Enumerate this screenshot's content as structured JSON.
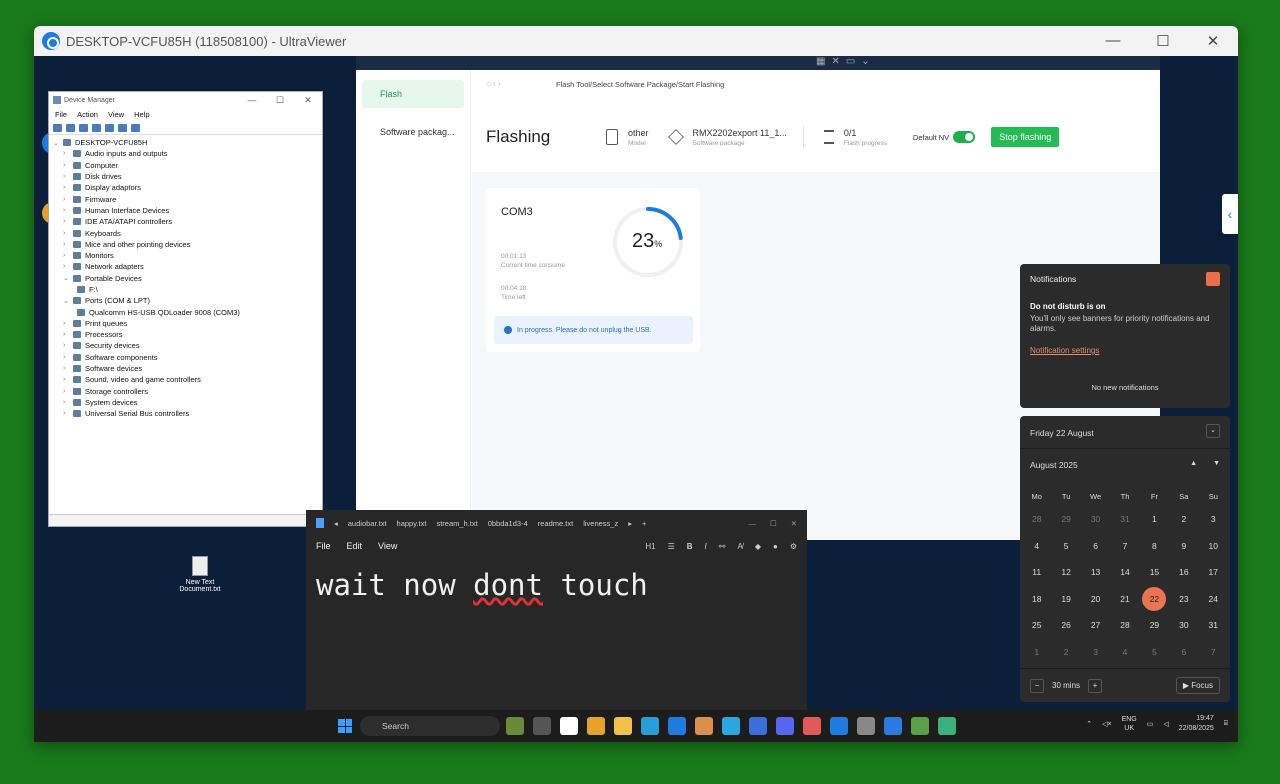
{
  "window": {
    "title": "DESKTOP-VCFU85H (118508100) - UltraViewer",
    "controls": [
      "—",
      "☐",
      "✕"
    ]
  },
  "device_manager": {
    "title": "Device Manager",
    "menu": [
      "File",
      "Action",
      "View",
      "Help"
    ],
    "root": "DESKTOP-VCFU85H",
    "items": [
      {
        "label": "Audio inputs and outputs",
        "indent": 1,
        "chev": "›"
      },
      {
        "label": "Computer",
        "indent": 1,
        "chev": "›"
      },
      {
        "label": "Disk drives",
        "indent": 1,
        "chev": "›"
      },
      {
        "label": "Display adaptors",
        "indent": 1,
        "chev": "›"
      },
      {
        "label": "Firmware",
        "indent": 1,
        "chev": "›"
      },
      {
        "label": "Human Interface Devices",
        "indent": 1,
        "chev": "›"
      },
      {
        "label": "IDE ATA/ATAPI controllers",
        "indent": 1,
        "chev": "›"
      },
      {
        "label": "Keyboards",
        "indent": 1,
        "chev": "›"
      },
      {
        "label": "Mice and other pointing devices",
        "indent": 1,
        "chev": "›"
      },
      {
        "label": "Monitors",
        "indent": 1,
        "chev": "›"
      },
      {
        "label": "Network adapters",
        "indent": 1,
        "chev": "›"
      },
      {
        "label": "Portable Devices",
        "indent": 1,
        "chev": "⌄"
      },
      {
        "label": "F:\\",
        "indent": 2,
        "chev": ""
      },
      {
        "label": "Ports (COM & LPT)",
        "indent": 1,
        "chev": "⌄"
      },
      {
        "label": "Qualcomm HS-USB QDLoader 9008 (COM3)",
        "indent": 2,
        "chev": ""
      },
      {
        "label": "Print queues",
        "indent": 1,
        "chev": "›"
      },
      {
        "label": "Processors",
        "indent": 1,
        "chev": "›"
      },
      {
        "label": "Security devices",
        "indent": 1,
        "chev": "›"
      },
      {
        "label": "Software components",
        "indent": 1,
        "chev": "›"
      },
      {
        "label": "Software devices",
        "indent": 1,
        "chev": "›"
      },
      {
        "label": "Sound, video and game controllers",
        "indent": 1,
        "chev": "›"
      },
      {
        "label": "Storage controllers",
        "indent": 1,
        "chev": "›"
      },
      {
        "label": "System devices",
        "indent": 1,
        "chev": "›"
      },
      {
        "label": "Universal Serial Bus controllers",
        "indent": 1,
        "chev": "›"
      }
    ]
  },
  "desktop": {
    "new_text": "New Text Document.txt"
  },
  "flash_tool": {
    "breadcrumb": "Flash Tool/Select Software Package/Start Flashing",
    "sidebar": [
      "Flash",
      "Software packag..."
    ],
    "heading": "Flashing",
    "model_value": "other",
    "model_label": "Model",
    "package_value": "RMX2202export 11_1...",
    "package_label": "Software package",
    "progress_value": "0/1",
    "progress_label": "Flash progress",
    "default_nv": "Default NV",
    "stop_button": "Stop flashing",
    "card": {
      "port": "COM3",
      "elapsed": "00:01:13",
      "elapsed_label": "Current time consume",
      "remaining": "00:04:18",
      "remaining_label": "Time left",
      "percent": "23",
      "percent_unit": "%",
      "progress_fraction": 0.23,
      "info": "In progress. Please do not unplug the USB."
    }
  },
  "notepad": {
    "tabs": [
      "audiobar.txt",
      "happy.txt",
      "stream_h.txt",
      "0bbda1d3-4",
      "readme.txt",
      "liveness_z"
    ],
    "menu": [
      "File",
      "Edit",
      "View"
    ],
    "heading_select": "H1",
    "text_before": "wait now ",
    "text_misspelled": "dont",
    "text_after": " touch"
  },
  "notifications": {
    "title": "Notifications",
    "dnd_title": "Do not disturb is on",
    "dnd_desc": "You'll only see banners for priority notifications and alarms.",
    "settings_link": "Notification settings",
    "empty": "No new notifications"
  },
  "calendar": {
    "date_header": "Friday 22 August",
    "month": "August 2025",
    "weekdays": [
      "Mo",
      "Tu",
      "We",
      "Th",
      "Fr",
      "Sa",
      "Su"
    ],
    "days": [
      {
        "d": "28",
        "m": true
      },
      {
        "d": "29",
        "m": true
      },
      {
        "d": "30",
        "m": true
      },
      {
        "d": "31",
        "m": true
      },
      {
        "d": "1"
      },
      {
        "d": "2"
      },
      {
        "d": "3"
      },
      {
        "d": "4"
      },
      {
        "d": "5"
      },
      {
        "d": "6"
      },
      {
        "d": "7"
      },
      {
        "d": "8"
      },
      {
        "d": "9"
      },
      {
        "d": "10"
      },
      {
        "d": "11"
      },
      {
        "d": "12"
      },
      {
        "d": "13"
      },
      {
        "d": "14"
      },
      {
        "d": "15"
      },
      {
        "d": "16"
      },
      {
        "d": "17"
      },
      {
        "d": "18"
      },
      {
        "d": "19"
      },
      {
        "d": "20"
      },
      {
        "d": "21"
      },
      {
        "d": "22",
        "today": true
      },
      {
        "d": "23"
      },
      {
        "d": "24"
      },
      {
        "d": "25"
      },
      {
        "d": "26"
      },
      {
        "d": "27"
      },
      {
        "d": "28"
      },
      {
        "d": "29"
      },
      {
        "d": "30"
      },
      {
        "d": "31"
      },
      {
        "d": "1",
        "m": true
      },
      {
        "d": "2",
        "m": true
      },
      {
        "d": "3",
        "m": true
      },
      {
        "d": "4",
        "m": true
      },
      {
        "d": "5",
        "m": true
      },
      {
        "d": "6",
        "m": true
      },
      {
        "d": "7",
        "m": true
      }
    ],
    "focus_duration": "30 mins",
    "focus_button": "▶ Focus"
  },
  "taskbar": {
    "search_placeholder": "Search",
    "lang_line1": "ENG",
    "lang_line2": "UK",
    "time": "19:47",
    "date": "22/08/2025",
    "app_colors": [
      "#6a8a3a",
      "#555",
      "#fff",
      "#e7a22b",
      "#f2c14a",
      "#2a9dd8",
      "#1e7be0",
      "#d9904a",
      "#2aa7e0",
      "#3a6fd8",
      "#5865f2",
      "#e05a5a",
      "#1e7be0",
      "#888",
      "#2a7be0",
      "#5aa04a",
      "#3ab07a"
    ]
  }
}
